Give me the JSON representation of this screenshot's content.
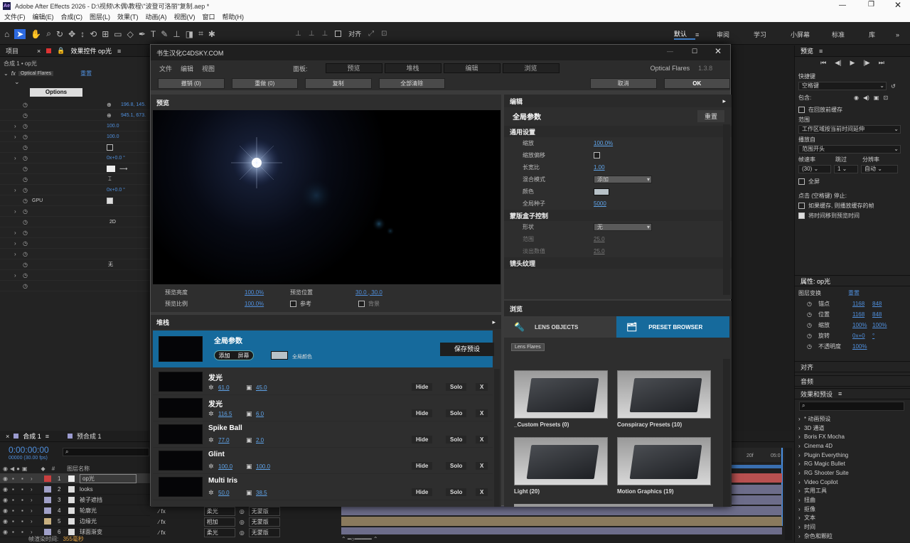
{
  "window": {
    "title": "Adobe After Effects 2026 - D:\\视频\\木偶\\教程\\\"波登可洛丽\"复制.aep *",
    "app_icon": "Ae"
  },
  "menu": [
    "文件(F)",
    "编辑(E)",
    "合成(C)",
    "图层(L)",
    "效果(T)",
    "动画(A)",
    "视图(V)",
    "窗口",
    "帮助(H)"
  ],
  "toolbar": {
    "align_label": "对齐",
    "workspaces": [
      "默认",
      "审阅",
      "学习",
      "小屏幕",
      "标准",
      "库"
    ]
  },
  "left_panel": {
    "tab_project": "项目",
    "tab_effects": "效果控件 op光",
    "breadcrumb": "合成 1 • op光",
    "fx_name": "Optical Flares",
    "reset": "重置",
    "options_btn": "Options",
    "values": [
      "196.8, 145.",
      "945.1, 673.",
      "100.0",
      "100.0",
      "0x+0.0 °",
      "0x+0.0 °",
      "2D",
      "无"
    ],
    "gpu": "GPU"
  },
  "timeline": {
    "tab1": "合成 1",
    "tab2": "预合成 1",
    "timecode": "0:00:00:00",
    "fps": "00000 (30.00 fps)",
    "col_name": "图层名称",
    "layers": [
      {
        "num": "1",
        "name": "op光",
        "color": "#c94040"
      },
      {
        "num": "2",
        "name": "looks",
        "color": "#a0a0c8"
      },
      {
        "num": "3",
        "name": "被子遮挡",
        "color": "#a0a0c8"
      },
      {
        "num": "4",
        "name": "轮廓光",
        "color": "#a0a0c8"
      },
      {
        "num": "5",
        "name": "边缘光",
        "color": "#c8b080"
      },
      {
        "num": "6",
        "name": "球面渐变",
        "color": "#a0a0c8"
      }
    ],
    "modes": [
      "柔光",
      "相加",
      "柔光"
    ],
    "trkmat": [
      "无蒙版",
      "无蒙版",
      "无蒙版"
    ],
    "render_label": "帧渲染时间:",
    "render_value": "355毫秒",
    "ruler": [
      "20f",
      "05:0"
    ]
  },
  "dialog": {
    "title": "书生汉化C4DSKY.COM",
    "menu": [
      "文件",
      "编辑",
      "视图"
    ],
    "panel_label": "面板:",
    "tabs": [
      "预览",
      "堆栈",
      "编辑",
      "浏览"
    ],
    "brand": "Optical Flares",
    "version": "1.3.8",
    "actions": [
      "撤销 (0)",
      "重做 (0)",
      "复制",
      "全部清除"
    ],
    "cancel": "取消",
    "ok": "OK",
    "preview": {
      "header": "预览",
      "brightness_label": "预览亮度",
      "brightness": "100.0%",
      "position_label": "预览位置",
      "position": "30.0 , 30.0",
      "scale_label": "预览比例",
      "scale": "100.0%",
      "ref_label": "参考",
      "bg_label": "背景"
    },
    "editor": {
      "header": "编辑",
      "global_title": "全局参数",
      "reset": "重置",
      "general": "通用设置",
      "props": [
        {
          "label": "缩放",
          "value": "100.0%"
        },
        {
          "label": "缩放偏移",
          "value": ""
        },
        {
          "label": "长宽比",
          "value": "1.00"
        },
        {
          "label": "混合模式",
          "value": "添加"
        },
        {
          "label": "颜色",
          "value": ""
        },
        {
          "label": "全局种子",
          "value": "5000"
        }
      ],
      "mask_section": "蒙版盒子控制",
      "mask_props": [
        {
          "label": "形状",
          "value": "无"
        },
        {
          "label": "范围",
          "value": "25.0"
        },
        {
          "label": "淡出数值",
          "value": "25.0"
        }
      ],
      "lens_section": "镜头纹理"
    },
    "stack": {
      "header": "堆栈",
      "global_title": "全局参数",
      "blend_add": "添加",
      "blend_screen": "屏幕",
      "global_color": "全局颜色",
      "save_preset": "保存预设",
      "items": [
        {
          "name": "发光",
          "v1": "61.0",
          "v2": "45.0"
        },
        {
          "name": "发光",
          "v1": "116.5",
          "v2": "6.0"
        },
        {
          "name": "Spike Ball",
          "v1": "77.0",
          "v2": "2.0"
        },
        {
          "name": "Glint",
          "v1": "100.0",
          "v2": "100.0"
        },
        {
          "name": "Multi Iris",
          "v1": "50.0",
          "v2": "38.5"
        }
      ],
      "hide": "Hide",
      "solo": "Solo",
      "x": "X"
    },
    "browser": {
      "header": "浏览",
      "tab_lens": "LENS OBJECTS",
      "tab_preset": "PRESET BROWSER",
      "crumb": "Lens Flares",
      "folders": [
        "_Custom Presets (0)",
        "Conspiracy Presets (10)",
        "Light (20)",
        "Motion Graphics (19)"
      ]
    }
  },
  "right_panel": {
    "preview_title": "预览",
    "shortcut_label": "快捷键",
    "shortcut_value": "空格键",
    "include_label": "包含:",
    "cache_before": "在回放前缓存",
    "range_label": "范围",
    "range_value": "工作区域按当前时间延伸",
    "play_from_label": "播放自",
    "play_from_value": "范围开头",
    "fps_label": "帧速率",
    "skip_label": "跳过",
    "res_label": "分辨率",
    "fps_value": "(30)",
    "skip_value": "1",
    "res_value": "自动",
    "fullscreen": "全屏",
    "click_stop": "点击 (空格键) 停止:",
    "cache_option": "如果缓存, 则播放缓存的帧",
    "move_time": "将时间移到预览时间",
    "props_title": "属性: op光",
    "layer_transform": "图层变换",
    "reset": "重置",
    "transform": [
      {
        "label": "锚点",
        "v1": "1168",
        "v2": "848"
      },
      {
        "label": "位置",
        "v1": "1168",
        "v2": "848"
      },
      {
        "label": "缩放",
        "v1": "100%",
        "v2": "100%"
      },
      {
        "label": "旋转",
        "v1": "0x+0",
        "v2": "°"
      },
      {
        "label": "不透明度",
        "v1": "100%",
        "v2": ""
      }
    ],
    "align": "对齐",
    "audio": "音频",
    "effects_title": "效果和预设",
    "effects": [
      "* 动画预设",
      "3D 通道",
      "Boris FX Mocha",
      "Cinema 4D",
      "Plugin Everything",
      "RG Magic Bullet",
      "RG Shooter Suite",
      "Video Copilot",
      "实用工具",
      "扭曲",
      "抠像",
      "文本",
      "时间",
      "杂色和颗粒"
    ]
  }
}
